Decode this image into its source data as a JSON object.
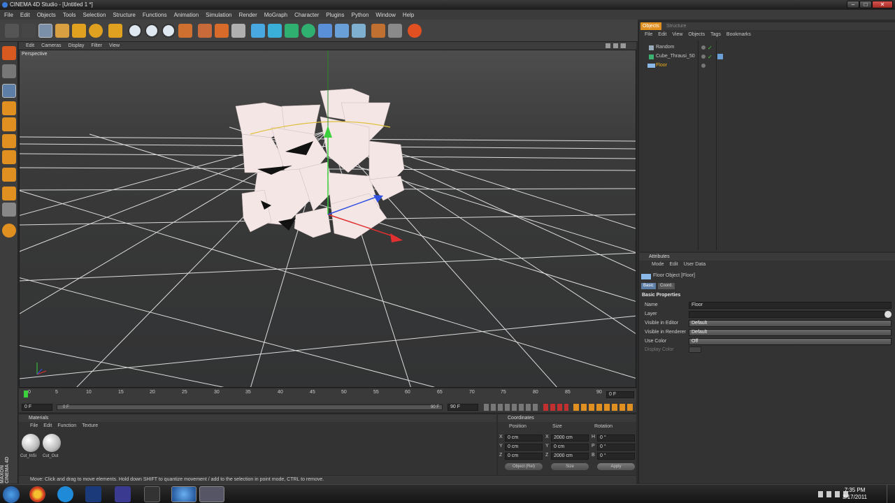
{
  "window": {
    "title": "CINEMA 4D Studio - [Untitled 1 *]",
    "minimize": "–",
    "maximize": "□",
    "close": "✕"
  },
  "menubar": [
    "File",
    "Edit",
    "Objects",
    "Tools",
    "Selection",
    "Structure",
    "Functions",
    "Animation",
    "Simulation",
    "Render",
    "MoGraph",
    "Character",
    "Plugins",
    "Python",
    "Window",
    "Help"
  ],
  "viewport": {
    "menu": [
      "Edit",
      "Cameras",
      "Display",
      "Filter",
      "View"
    ],
    "label": "Perspective"
  },
  "timeline": {
    "ticks": [
      "0",
      "5",
      "10",
      "15",
      "20",
      "25",
      "30",
      "35",
      "40",
      "45",
      "50",
      "55",
      "60",
      "65",
      "70",
      "75",
      "80",
      "85",
      "90"
    ],
    "current_frame": "0 F",
    "start_field": "0 F",
    "min_field": "0 F",
    "max_field": "90 F",
    "end_field": "90 F"
  },
  "materials": {
    "title": "Materials",
    "menu": [
      "File",
      "Edit",
      "Function",
      "Texture"
    ],
    "items": [
      "Cut_InSi",
      "Cut_Out"
    ]
  },
  "coordinates": {
    "title": "Coordinates",
    "headers": [
      "Position",
      "Size",
      "Rotation"
    ],
    "rows": [
      {
        "axis": "X",
        "pos": "0 cm",
        "size_axis": "X",
        "size": "2000 cm",
        "rot_axis": "H",
        "rot": "0 °"
      },
      {
        "axis": "Y",
        "pos": "0 cm",
        "size_axis": "Y",
        "size": "0 cm",
        "rot_axis": "P",
        "rot": "0 °"
      },
      {
        "axis": "Z",
        "pos": "0 cm",
        "size_axis": "Z",
        "size": "2000 cm",
        "rot_axis": "B",
        "rot": "0 °"
      }
    ],
    "mode_dropdown": "Object (Rel)",
    "size_dropdown": "Size",
    "apply_label": "Apply"
  },
  "status": "Move: Click and drag to move elements. Hold down SHIFT to quantize movement / add to the selection in point mode, CTRL to remove.",
  "brand": "MAXON CINEMA 4D",
  "object_manager": {
    "tabs": [
      "Objects",
      "Structure"
    ],
    "menu": [
      "File",
      "Edit",
      "View",
      "Objects",
      "Tags",
      "Bookmarks"
    ],
    "objects": [
      "Random",
      "Cube_Thrausi_50",
      "Floor"
    ]
  },
  "attributes": {
    "title": "Attributes",
    "menu": [
      "Mode",
      "Edit",
      "User Data"
    ],
    "object_title": "Floor Object [Floor]",
    "tabs": [
      "Basic",
      "Coord."
    ],
    "section": "Basic Properties",
    "fields": [
      {
        "label": "Name",
        "value": "Floor"
      },
      {
        "label": "Layer",
        "value": ""
      },
      {
        "label": "Visible in Editor",
        "value": "Default"
      },
      {
        "label": "Visible in Renderer",
        "value": "Default"
      },
      {
        "label": "Use Color",
        "value": "Off"
      },
      {
        "label": "Display Color",
        "value": ""
      }
    ]
  },
  "taskbar": {
    "time": "7:35 PM",
    "date": "3/17/2011"
  },
  "colors": {
    "accent": "#f5a623",
    "selected_object": "#f0b020",
    "bg": "#2b2b2b",
    "panel": "#333333"
  }
}
